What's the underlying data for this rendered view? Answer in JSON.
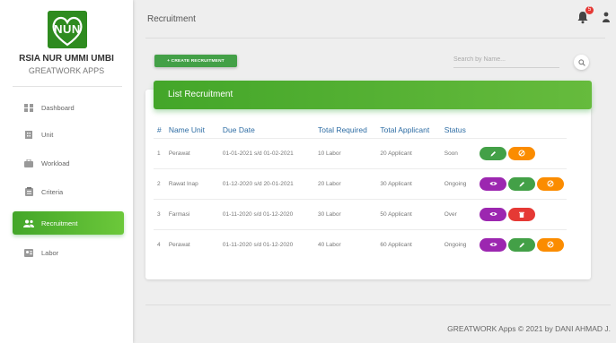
{
  "brand": {
    "logo_text": "NUN",
    "name": "RSIA NUR UMMI UMBI",
    "subtitle": "GREATWORK APPS",
    "color": "#2e8b1f"
  },
  "sidebar": {
    "items": [
      {
        "label": "Dashboard",
        "icon": "dashboard-icon"
      },
      {
        "label": "Unit",
        "icon": "building-icon"
      },
      {
        "label": "Workload",
        "icon": "briefcase-icon"
      },
      {
        "label": "Criteria",
        "icon": "clipboard-icon"
      },
      {
        "label": "Recruitment",
        "icon": "people-icon",
        "active": true
      },
      {
        "label": "Labor",
        "icon": "id-card-icon"
      }
    ]
  },
  "header": {
    "title": "Recruitment",
    "notification_count": "5"
  },
  "toolbar": {
    "create_label": "+ CREATE RECRUITMENT",
    "search_placeholder": "Search by Name..."
  },
  "card": {
    "title": "List Recruitment"
  },
  "table": {
    "columns": [
      "#",
      "Name Unit",
      "Due Date",
      "Total Required",
      "Total Applicant",
      "Status"
    ],
    "rows": [
      {
        "no": "1",
        "unit": "Perawat",
        "due": "01-01-2021 s/d 01-02-2021",
        "required": "10 Labor",
        "applicant": "20 Applicant",
        "status": "Soon",
        "actions": [
          "edit",
          "cancel"
        ]
      },
      {
        "no": "2",
        "unit": "Rawat Inap",
        "due": "01-12-2020 s/d 20-01-2021",
        "required": "20 Labor",
        "applicant": "30 Applicant",
        "status": "Ongoing",
        "actions": [
          "view",
          "edit",
          "cancel"
        ]
      },
      {
        "no": "3",
        "unit": "Farmasi",
        "due": "01-11-2020 s/d 01-12-2020",
        "required": "30 Labor",
        "applicant": "50 Applicant",
        "status": "Over",
        "actions": [
          "view",
          "delete"
        ]
      },
      {
        "no": "4",
        "unit": "Perawat",
        "due": "01-11-2020 s/d 01-12-2020",
        "required": "40 Labor",
        "applicant": "60 Applicant",
        "status": "Ongoing",
        "actions": [
          "view",
          "edit",
          "cancel"
        ]
      }
    ]
  },
  "footer": {
    "text": "GREATWORK Apps © 2021 by DANI AHMAD J."
  },
  "colors": {
    "accent_green": "#43a047",
    "view_purple": "#9c27b0",
    "cancel_orange": "#fb8c00",
    "delete_red": "#e53935",
    "header_blue": "#2e6da4"
  }
}
